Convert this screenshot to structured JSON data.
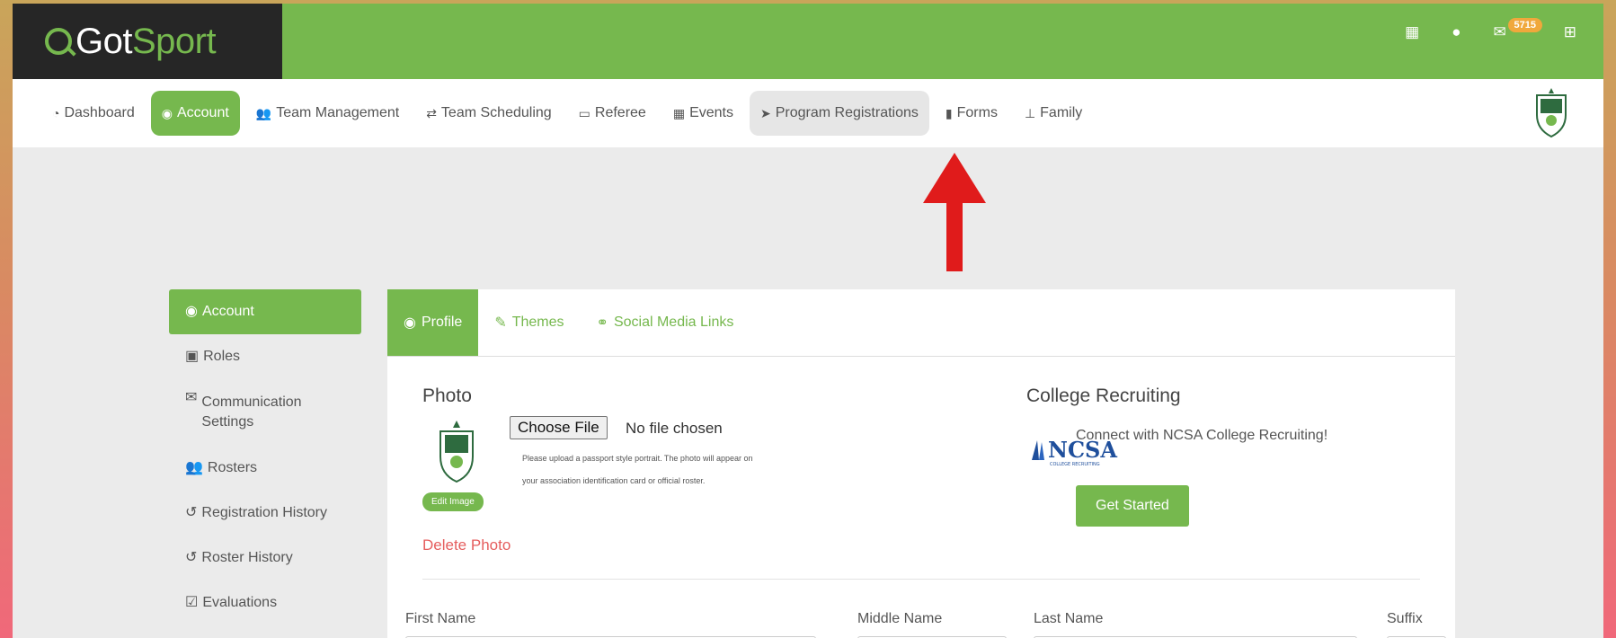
{
  "app": {
    "logo_got": "Got",
    "logo_sport": "Sport"
  },
  "topbar": {
    "icons": [
      "qr-code-icon",
      "user-icon",
      "envelope-icon",
      "apps-grid-icon"
    ],
    "mail_count": "5715"
  },
  "nav": {
    "items": [
      {
        "label": "Dashboard",
        "icon": "dashboard-icon"
      },
      {
        "label": "Account",
        "icon": "user-circle-icon",
        "active": true
      },
      {
        "label": "Team Management",
        "icon": "users-icon"
      },
      {
        "label": "Team Scheduling",
        "icon": "exchange-icon"
      },
      {
        "label": "Referee",
        "icon": "calendar-icon"
      },
      {
        "label": "Events",
        "icon": "calendar-grid-icon"
      },
      {
        "label": "Program Registrations",
        "icon": "paper-plane-icon",
        "hover": true
      },
      {
        "label": "Forms",
        "icon": "file-icon"
      },
      {
        "label": "Family",
        "icon": "sitemap-icon"
      }
    ]
  },
  "sidebar": {
    "items": [
      {
        "label": "Account",
        "icon": "user-circle-icon",
        "active": true
      },
      {
        "label": "Roles",
        "icon": "id-card-icon"
      },
      {
        "label": "Communication Settings",
        "icon": "envelope-icon"
      },
      {
        "label": "Rosters",
        "icon": "users-icon"
      },
      {
        "label": "Registration History",
        "icon": "history-icon"
      },
      {
        "label": "Roster History",
        "icon": "history-icon"
      },
      {
        "label": "Evaluations",
        "icon": "calendar-check-icon"
      }
    ]
  },
  "tabs": [
    {
      "label": "Profile",
      "icon": "user-circle-icon",
      "active": true
    },
    {
      "label": "Themes",
      "icon": "brush-icon"
    },
    {
      "label": "Social Media Links",
      "icon": "link-icon"
    }
  ],
  "photo": {
    "title": "Photo",
    "choose_file": "Choose File",
    "no_file": "No file chosen",
    "note": "Please upload a passport style portrait. The photo will appear on your association identification card or official roster.",
    "edit_image": "Edit Image",
    "delete_photo": "Delete Photo"
  },
  "recruiting": {
    "title": "College Recruiting",
    "logo_text": "NCSA",
    "logo_sub": "COLLEGE RECRUITING",
    "text": "Connect with NCSA College Recruiting!",
    "button": "Get Started"
  },
  "form": {
    "first_name": "First Name",
    "middle_name": "Middle Name",
    "last_name": "Last Name",
    "suffix": "Suffix"
  },
  "colors": {
    "brand_green": "#76b84e",
    "dark": "#262626",
    "badge": "#f0a83c",
    "delete": "#e55e5e",
    "arrow": "#e01b1b"
  }
}
